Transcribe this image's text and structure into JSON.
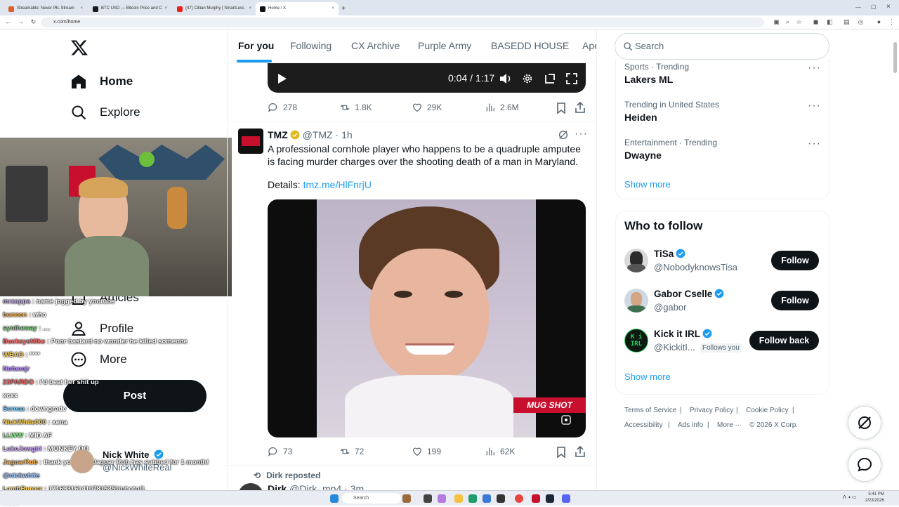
{
  "browser": {
    "tabs": [
      {
        "label": "Streamable: Never IRL Stream",
        "color": "#e05c2b"
      },
      {
        "label": "BTC USD — Bitcoin Price and C",
        "color": "#1a1a1a"
      },
      {
        "label": "(47) Cillian Murphy | SmartLess",
        "color": "#e62117"
      },
      {
        "label": "Home / X",
        "color": "#111111"
      }
    ],
    "url": "x.com/home"
  },
  "nav": {
    "home": "Home",
    "explore": "Explore",
    "articles": "Articles",
    "profile": "Profile",
    "more": "More",
    "post": "Post"
  },
  "chat": {
    "lines": [
      {
        "user": "mrzappa",
        "text": "name jogged by youtube",
        "color": "#c5a3ff"
      },
      {
        "user": "bunnen",
        "text": "who",
        "color": "#ffb347"
      },
      {
        "user": "syntheway",
        "text": "....",
        "color": "#7fd37f"
      },
      {
        "user": "BuckeyeMike",
        "text": "Poor bastard no wonder he killed someone",
        "color": "#ff6b6b"
      },
      {
        "user": "WBAD",
        "text": "****",
        "color": "#ffd65c"
      },
      {
        "user": "Nofacejr",
        "text": "",
        "color": "#b98cff"
      },
      {
        "user": "23PARDO",
        "text": "i'd beat her shit up",
        "color": "#ff5f5f"
      },
      {
        "user": "xcxx",
        "text": "",
        "color": "#ffffff"
      },
      {
        "user": "Screaa",
        "text": "downgrade",
        "color": "#7ad0ff"
      },
      {
        "user": "NickWhite000",
        "text": "xena",
        "color": "#ffd65c"
      },
      {
        "user": "LLWW",
        "text": "MID AF",
        "color": "#8aff8a"
      },
      {
        "user": "LukeJowgirl",
        "text": "MONKEY DO",
        "color": "#cfa6ff"
      },
      {
        "user": "JaguarRob",
        "text": "thank you sub. Jaguar Rob has subbed for 1 month!",
        "color": "#ffb347"
      },
      {
        "user": "@nickwhite",
        "text": "",
        "color": "#9fc8ff"
      },
      {
        "user": "LambBurger",
        "text": "1716931614107815351/photo/1",
        "color": "#ffd65c"
      },
      {
        "user": "xxxlc",
        "text": "",
        "color": "#ff9a9a"
      }
    ],
    "overlay_name": "Nick White",
    "overlay_handle": "@NickWhiteReal"
  },
  "timeline": {
    "tabs": [
      "For you",
      "Following",
      "CX Archive",
      "Purple Army",
      "BASEDD HOUSE",
      "Ape"
    ],
    "video": {
      "time": "0:04 / 1:17"
    },
    "prev_tweet": {
      "replies": "278",
      "reposts": "1.8K",
      "likes": "29K",
      "views": "2.6M"
    },
    "tweet": {
      "name": "TMZ",
      "handle": "@TMZ",
      "time": "1h",
      "text": "A professional cornhole player who happens to be a quadruple amputee is facing murder charges over the shooting death of a man in Maryland.",
      "details_label": "Details:",
      "link": "tmz.me/HlFnrjU",
      "media_badge": "MUG SHOT",
      "replies": "73",
      "reposts": "72",
      "likes": "199",
      "views": "62K"
    },
    "next_tweet": {
      "repost_label": "Dirk reposted",
      "name": "Dirk",
      "handle": "@Dirk_mp4",
      "time": "3m"
    }
  },
  "sidebar": {
    "search_placeholder": "Search",
    "trends": [
      {
        "meta": "Sports · Trending",
        "name": "Lakers ML"
      },
      {
        "meta": "Trending in United States",
        "name": "Heiden"
      },
      {
        "meta": "Entertainment · Trending",
        "name": "Dwayne"
      }
    ],
    "trends_show_more": "Show more",
    "who_to_follow_title": "Who to follow",
    "suggestions": [
      {
        "name": "TiSa",
        "handle": "@NobodyknowsTisa",
        "button": "Follow",
        "badge": ""
      },
      {
        "name": "Gabor Cselle",
        "handle": "@gabor",
        "button": "Follow",
        "badge": ""
      },
      {
        "name": "Kick it IRL",
        "handle": "@KickitI...",
        "button": "Follow back",
        "badge": "Follows you"
      }
    ],
    "wtf_show_more": "Show more",
    "footer": [
      "Terms of Service",
      "Privacy Policy",
      "Cookie Policy",
      "Accessibility",
      "Ads info",
      "More ···",
      "© 2026 X Corp."
    ]
  },
  "taskbar": {
    "search": "Search",
    "time": "5:41 PM",
    "date": "2/23/2026"
  },
  "colors": {
    "accent": "#1d9bf0",
    "verified_gold": "#e2b719",
    "tmz_red": "#c8102e"
  }
}
